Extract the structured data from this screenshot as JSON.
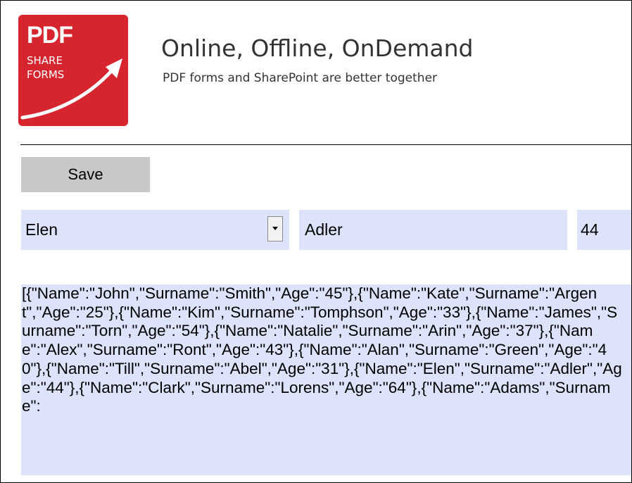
{
  "header": {
    "logo": {
      "line1": "PDF",
      "line2": "SHARE",
      "line3": "FORMS"
    },
    "title": "Online, Offline, OnDemand",
    "subtitle": "PDF forms and SharePoint are better together"
  },
  "toolbar": {
    "save_label": "Save"
  },
  "form": {
    "name_value": "Elen",
    "surname_value": "Adler",
    "age_value": "44"
  },
  "json_text": "[{\"Name\":\"John\",\"Surname\":\"Smith\",\"Age\":\"45\"},{\"Name\":\"Kate\",\"Surname\":\"Argent\",\"Age\":\"25\"},{\"Name\":\"Kim\",\"Surname\":\"Tomphson\",\"Age\":\"33\"},{\"Name\":\"James\",\"Surname\":\"Torn\",\"Age\":\"54\"},{\"Name\":\"Natalie\",\"Surname\":\"Arin\",\"Age\":\"37\"},{\"Name\":\"Alex\",\"Surname\":\"Ront\",\"Age\":\"43\"},{\"Name\":\"Alan\",\"Surname\":\"Green\",\"Age\":\"40\"},{\"Name\":\"Till\",\"Surname\":\"Abel\",\"Age\":\"31\"},{\"Name\":\"Elen\",\"Surname\":\"Adler\",\"Age\":\"44\"},{\"Name\":\"Clark\",\"Surname\":\"Lorens\",\"Age\":\"64\"},{\"Name\":\"Adams\",\"Surname\":",
  "colors": {
    "logo_red": "#d7252f",
    "field_bg": "#dde3fb",
    "button_bg": "#c8c8c8"
  },
  "icons": {
    "logo_arrow": "arrow-up-right-icon",
    "dropdown": "chevron-down-icon"
  }
}
